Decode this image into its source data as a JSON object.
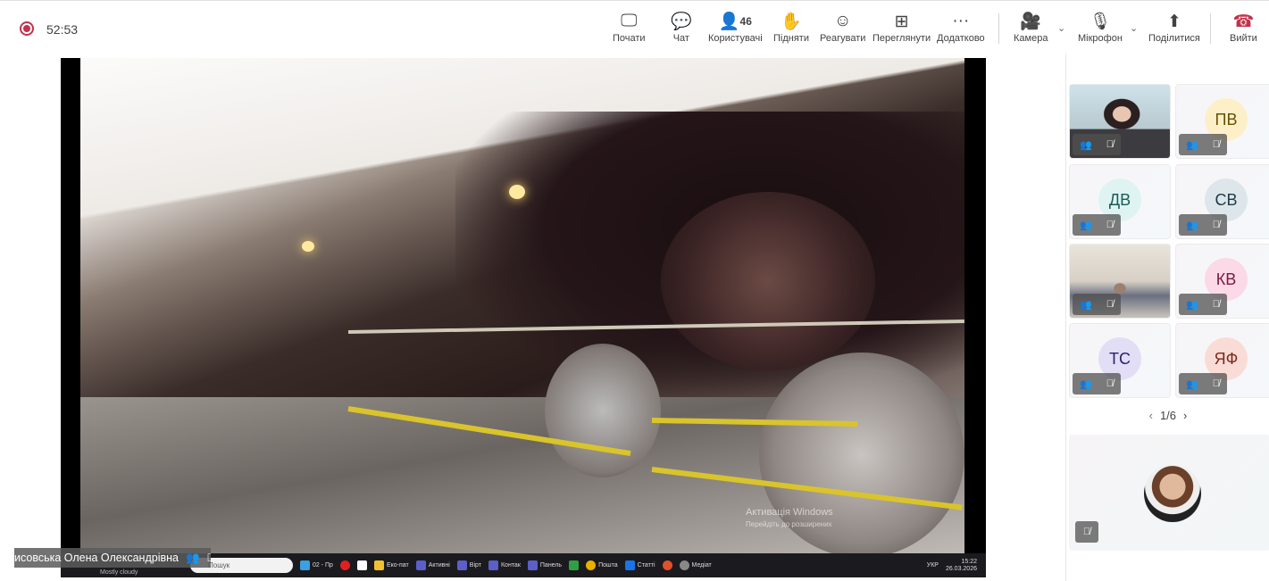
{
  "meeting": {
    "timer": "52:53"
  },
  "toolbar": [
    {
      "label": "Почати",
      "icon": "present-icon",
      "glyph": "🖵"
    },
    {
      "label": "Чат",
      "icon": "chat-icon",
      "glyph": "💬"
    },
    {
      "label": "Користувачі",
      "icon": "people-icon",
      "glyph": "👤",
      "count": "46"
    },
    {
      "label": "Підняти",
      "icon": "raise-hand-icon",
      "glyph": "✋"
    },
    {
      "label": "Реагувати",
      "icon": "emoji-icon",
      "glyph": "☺"
    },
    {
      "label": "Переглянути",
      "icon": "view-grid-icon",
      "glyph": "⊞"
    },
    {
      "label": "Додатково",
      "icon": "more-icon",
      "glyph": "···"
    },
    {
      "label": "Камера",
      "icon": "camera-off-icon",
      "glyph": "🎥"
    },
    {
      "label": "Мікрофон",
      "icon": "mic-off-icon",
      "glyph": "🎙"
    },
    {
      "label": "Поділитися",
      "icon": "share-icon",
      "glyph": "⬆"
    },
    {
      "label": "Вийти",
      "icon": "hang-up-icon",
      "glyph": "☎"
    }
  ],
  "shared_screen": {
    "presenter_name": "исовська Олена Олександрівна",
    "watermark_title": "Активація Windows",
    "watermark_sub": "Перейдіть до розширених",
    "taskbar": {
      "weather": "Mostly cloudy",
      "search": "Пошук",
      "items": [
        "02 - Пр",
        "Еко-пат",
        "Активні",
        "Вірт",
        "Контак",
        "Панель",
        "Пошта",
        "Статті",
        "Медіат"
      ],
      "language": "УКР",
      "time": "15:22",
      "date": "26.03.2026"
    }
  },
  "participants": [
    {
      "initials": "",
      "video": true,
      "kind": "woman"
    },
    {
      "initials": "ПВ",
      "bg": "#fdf0c8",
      "fg": "#6b4e00"
    },
    {
      "initials": "ДВ",
      "bg": "#dff4f2",
      "fg": "#1a5c56"
    },
    {
      "initials": "СВ",
      "bg": "#dde6ea",
      "fg": "#1d3a48"
    },
    {
      "initials": "",
      "video": true,
      "kind": "room"
    },
    {
      "initials": "КВ",
      "bg": "#fbd9e6",
      "fg": "#7a1a3c"
    },
    {
      "initials": "ТС",
      "bg": "#e2def5",
      "fg": "#2a2070"
    },
    {
      "initials": "ЯФ",
      "bg": "#fadcd6",
      "fg": "#7a2a1a"
    }
  ],
  "pager": {
    "label": "1/6"
  }
}
